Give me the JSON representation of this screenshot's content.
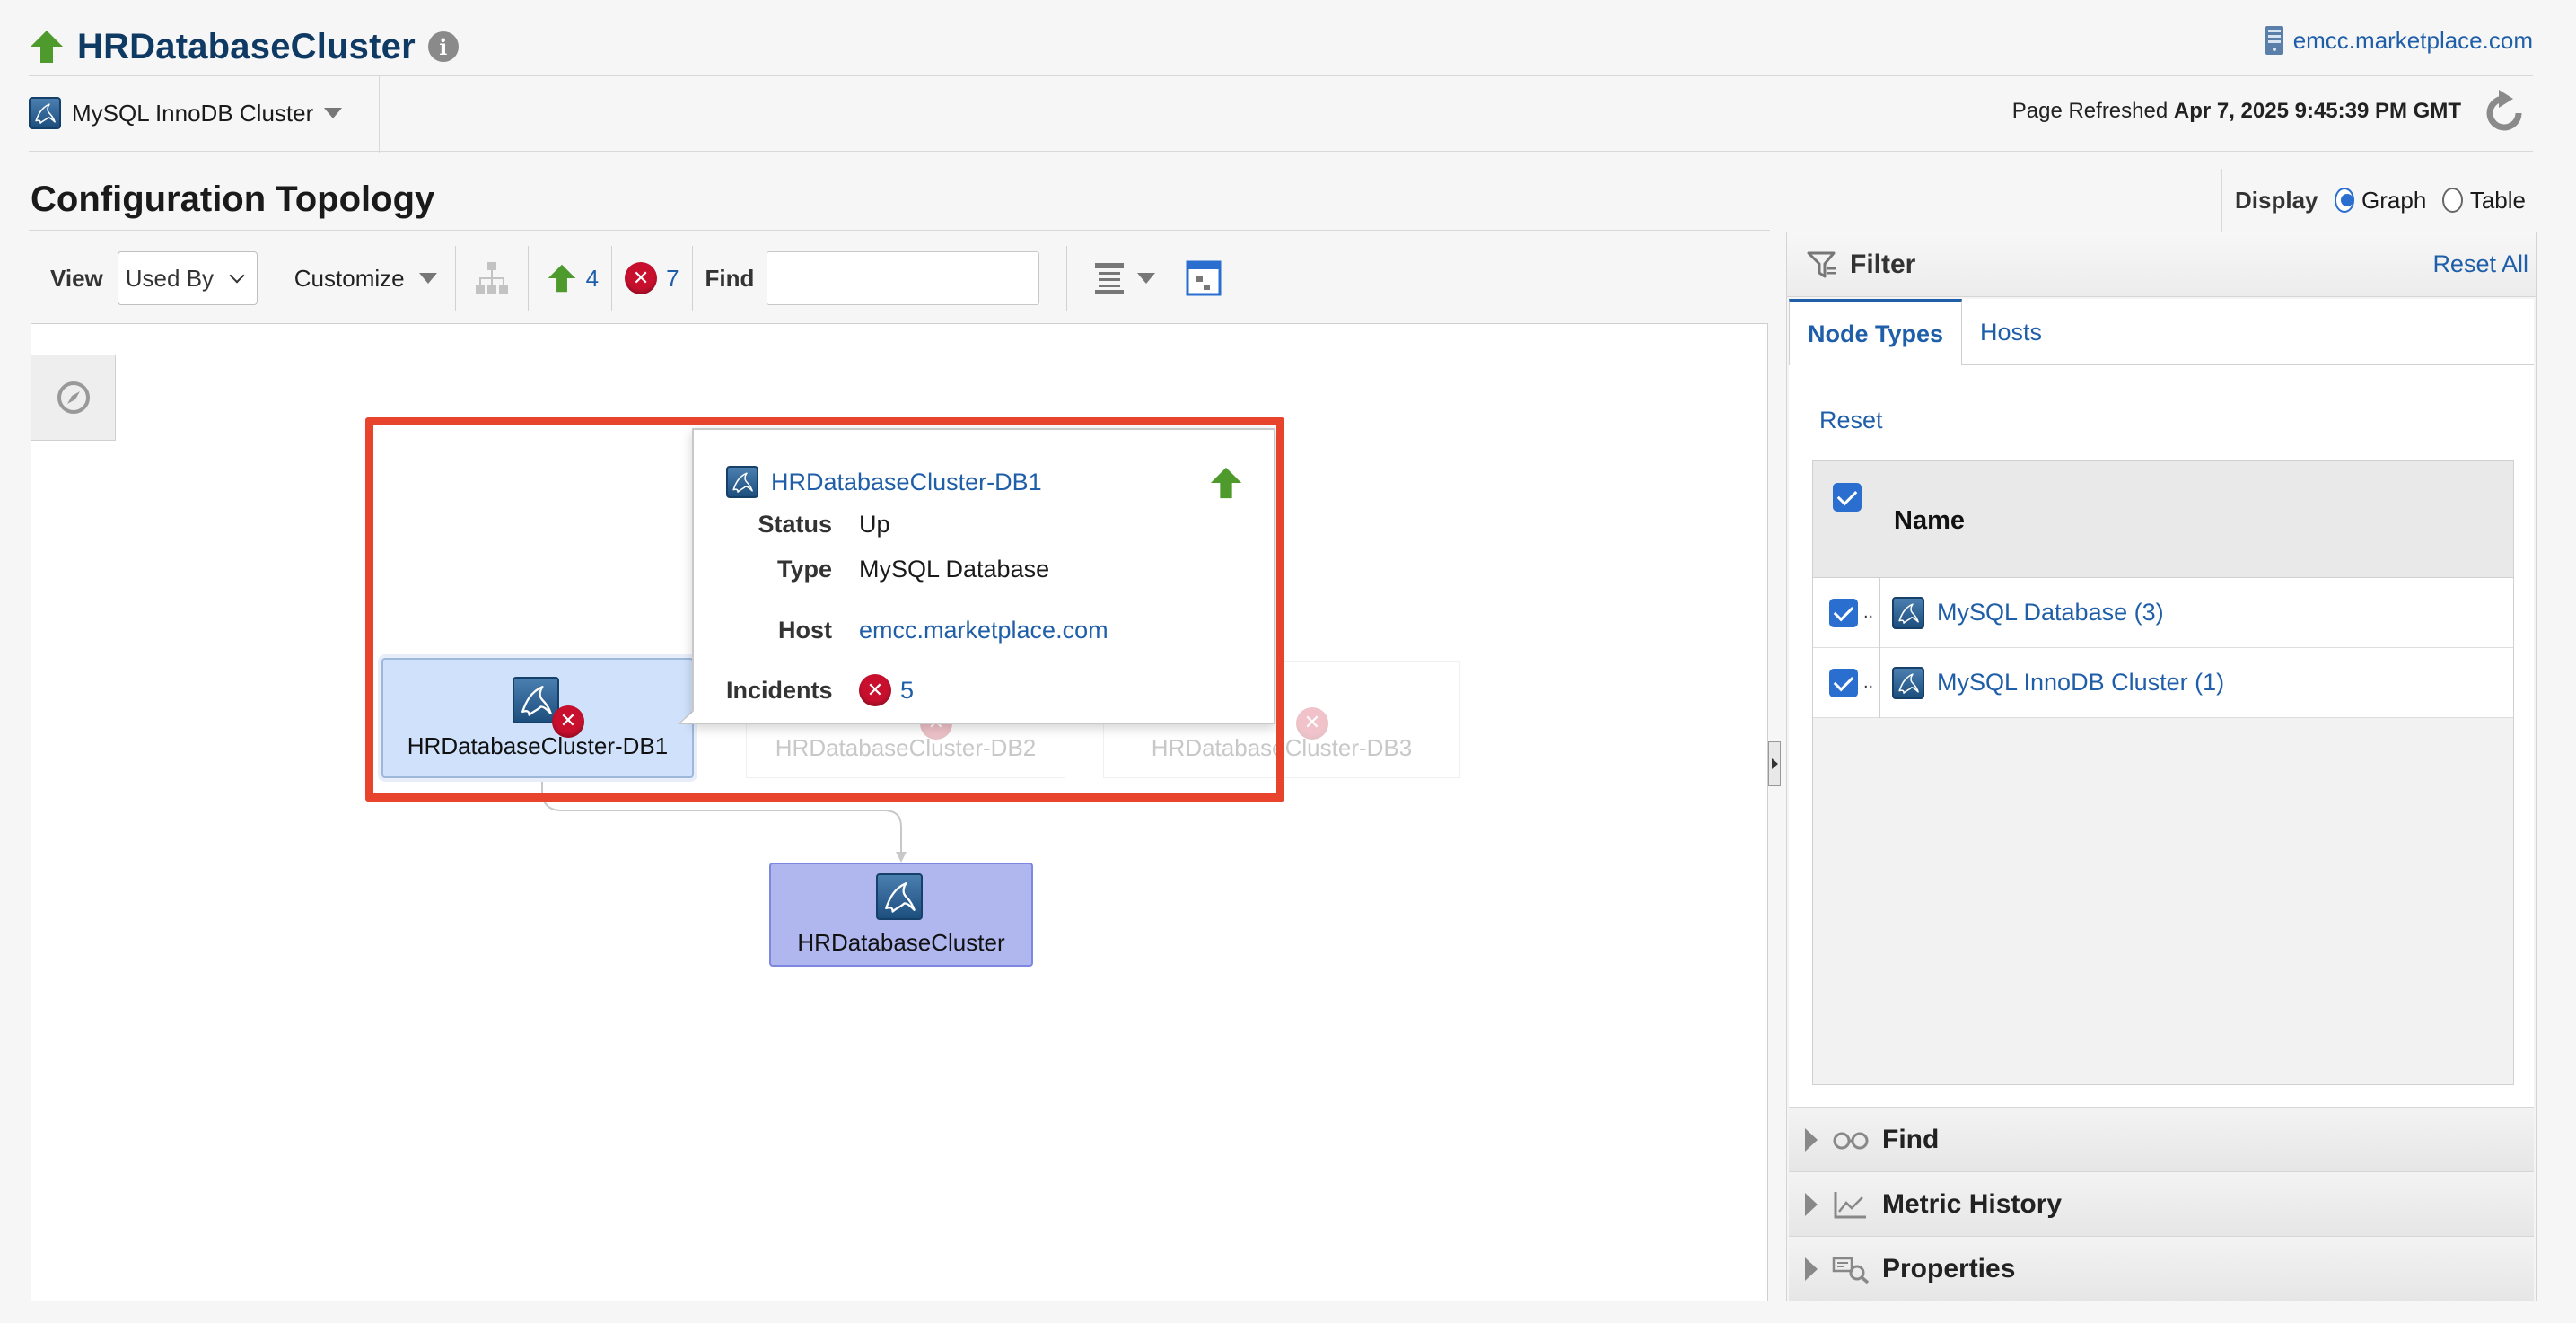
{
  "header": {
    "title": "HRDatabaseCluster",
    "host": "emcc.marketplace.com",
    "target_type": "MySQL InnoDB Cluster",
    "refreshed_label": "Page Refreshed",
    "refreshed_time": "Apr 7, 2025 9:45:39 PM GMT"
  },
  "section": {
    "title": "Configuration Topology",
    "display_label": "Display",
    "display_options": [
      "Graph",
      "Table"
    ],
    "display_selected": "Graph"
  },
  "toolbar": {
    "view_label": "View",
    "view_value": "Used By",
    "customize_label": "Customize",
    "up_count": "4",
    "incident_count": "7",
    "find_label": "Find",
    "find_value": ""
  },
  "graph": {
    "nodes": [
      {
        "label": "HRDatabaseCluster-DB1",
        "state": "selected"
      },
      {
        "label": "HRDatabaseCluster-DB2",
        "state": "faded"
      },
      {
        "label": "HRDatabaseCluster-DB3",
        "state": "faded"
      },
      {
        "label": "HRDatabaseCluster",
        "state": "cluster"
      }
    ]
  },
  "popup": {
    "name": "HRDatabaseCluster-DB1",
    "status_key": "Status",
    "status_val": "Up",
    "type_key": "Type",
    "type_val": "MySQL Database",
    "host_key": "Host",
    "host_val": "emcc.marketplace.com",
    "incidents_key": "Incidents",
    "incidents_val": "5"
  },
  "filter": {
    "title": "Filter",
    "reset_all": "Reset All",
    "tabs": [
      "Node Types",
      "Hosts"
    ],
    "active_tab": "Node Types",
    "reset": "Reset",
    "col_name": "Name",
    "rows": [
      {
        "label": "MySQL Database (3)",
        "checked": true
      },
      {
        "label": "MySQL InnoDB Cluster (1)",
        "checked": true
      }
    ],
    "accordions": [
      "Find",
      "Metric History",
      "Properties"
    ]
  },
  "colors": {
    "accent": "#1f5ea8",
    "up": "#4e9a2d",
    "error": "#c8102e",
    "highlight": "#e8432c",
    "cluster_node": "#b0b6ee"
  },
  "icons": [
    "up-arrow-icon",
    "info-icon",
    "server-icon",
    "mysql-icon",
    "refresh-icon",
    "error-icon",
    "compass-icon",
    "filter-icon",
    "glasses-icon",
    "chart-icon",
    "properties-icon"
  ]
}
